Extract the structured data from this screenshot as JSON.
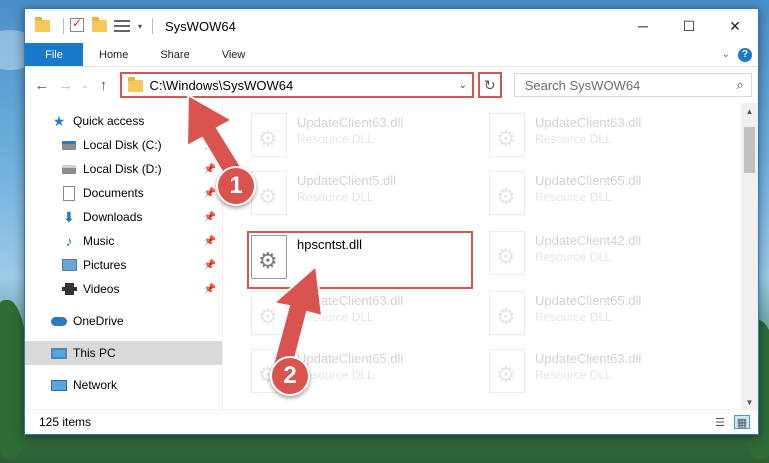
{
  "window": {
    "title": "SysWOW64",
    "controls": {
      "minimize": "─",
      "maximize": "☐",
      "close": "✕"
    }
  },
  "ribbon": {
    "tabs": [
      "File",
      "Home",
      "Share",
      "View"
    ],
    "collapse_icon": "chevron-down-icon",
    "help_label": "?"
  },
  "addressbar": {
    "back": "←",
    "forward": "→",
    "up": "↑",
    "path": "C:\\Windows\\SysWOW64",
    "refresh": "↻",
    "dropdown": "⌄"
  },
  "search": {
    "placeholder": "Search SysWOW64",
    "icon": "⌕"
  },
  "nav_pane": {
    "items": [
      {
        "label": "Quick access",
        "icon": "star-icon"
      },
      {
        "label": "Local Disk (C:)",
        "icon": "drive-icon",
        "pinned": true
      },
      {
        "label": "Local Disk (D:)",
        "icon": "drive-icon",
        "pinned": true
      },
      {
        "label": "Documents",
        "icon": "documents-icon",
        "pinned": true
      },
      {
        "label": "Downloads",
        "icon": "downloads-icon",
        "pinned": true
      },
      {
        "label": "Music",
        "icon": "music-icon",
        "pinned": true
      },
      {
        "label": "Pictures",
        "icon": "pictures-icon",
        "pinned": true
      },
      {
        "label": "Videos",
        "icon": "videos-icon",
        "pinned": true
      },
      {
        "label": "OneDrive",
        "icon": "cloud-icon"
      },
      {
        "label": "This PC",
        "icon": "computer-icon",
        "selected": true
      },
      {
        "label": "Network",
        "icon": "network-icon"
      }
    ]
  },
  "files": {
    "highlighted": {
      "name": "hpscntst.dll",
      "description": ""
    },
    "faded": [
      {
        "name": "UpdateClient63.dll",
        "description": "Resource DLL"
      },
      {
        "name": "UpdateClient63.dll",
        "description": "Resource DLL"
      },
      {
        "name": "UpdateClient5.dll",
        "description": "Resource DLL"
      },
      {
        "name": "UpdateClient65.dll",
        "description": "Resource DLL"
      },
      {
        "name": "UpdateClient42.dll",
        "description": "Resource DLL"
      },
      {
        "name": "UpdateClient63.dll",
        "description": "Resource DLL"
      },
      {
        "name": "UpdateClient65.dll",
        "description": "Resource DLL"
      },
      {
        "name": "UpdateClient65.dll",
        "description": "Resource DLL"
      },
      {
        "name": "UpdateClient63.dll",
        "description": "Resource DLL"
      }
    ]
  },
  "statusbar": {
    "item_count": "125 items"
  },
  "annotations": {
    "step1": "1",
    "step2": "2",
    "color": "#d9534f"
  }
}
